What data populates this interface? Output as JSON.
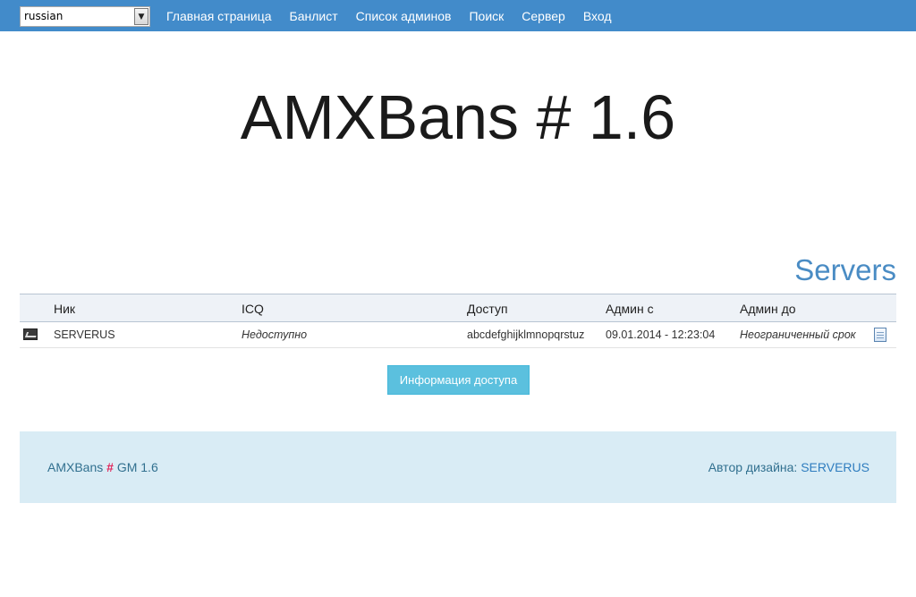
{
  "nav": {
    "language": "russian",
    "links": [
      "Главная страница",
      "Банлист",
      "Список админов",
      "Поиск",
      "Сервер",
      "Вход"
    ]
  },
  "title": "AMXBans # 1.6",
  "section_heading": "Servers",
  "table": {
    "headers": [
      "Ник",
      "ICQ",
      "Доступ",
      "Админ с",
      "Админ до"
    ],
    "rows": [
      {
        "nick": "SERVERUS",
        "icq": "Недоступно",
        "access": "abcdefghijklmnopqrstuz",
        "admin_from": "09.01.2014 - 12:23:04",
        "admin_to": "Неограниченный срок"
      }
    ]
  },
  "info_button": "Информация доступа",
  "footer": {
    "brand_prefix": "AMXBans",
    "brand_hash": "#",
    "brand_suffix": "GM 1.6",
    "author_label": "Автор дизайна:",
    "author_name": "SERVERUS"
  },
  "colors": {
    "navbar": "#428bca",
    "heading": "#4a8cc4",
    "button": "#5bc0de",
    "footer_bg": "#d9ecf5"
  }
}
